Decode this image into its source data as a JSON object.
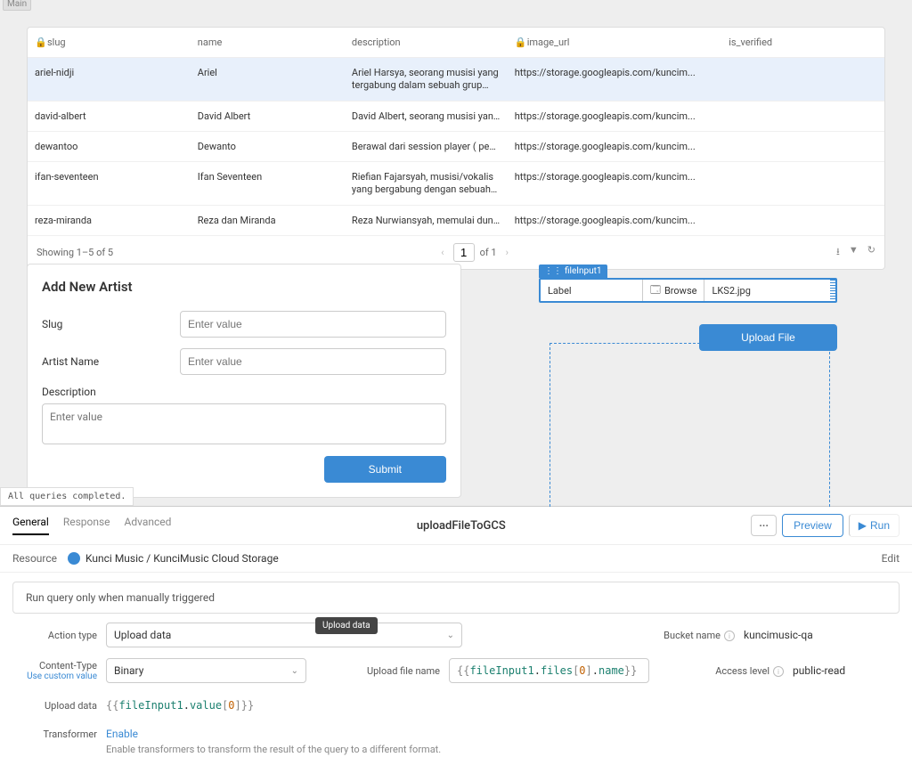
{
  "canvas": {
    "main_label": "Main",
    "status": "All queries completed."
  },
  "table": {
    "columns": [
      {
        "label": "slug",
        "locked": true
      },
      {
        "label": "name",
        "locked": false
      },
      {
        "label": "description",
        "locked": false
      },
      {
        "label": "image_url",
        "locked": true
      },
      {
        "label": "is_verified",
        "locked": false
      }
    ],
    "rows": [
      {
        "slug": "ariel-nidji",
        "name": "Ariel",
        "description": "Ariel Harsya, seorang musisi yang tergabung dalam sebuah grup band musik papan atas",
        "image_url": "https://storage.googleapis.com/kuncim...",
        "is_verified": ""
      },
      {
        "slug": "david-albert",
        "name": "David Albert",
        "description": "David Albert, seorang musisi yang terg...",
        "image_url": "https://storage.googleapis.com/kuncim...",
        "is_verified": ""
      },
      {
        "slug": "dewantoo",
        "name": "Dewanto",
        "description": "Berawal dari session player ( pengiring ...",
        "image_url": "https://storage.googleapis.com/kuncim...",
        "is_verified": ""
      },
      {
        "slug": "ifan-seventeen",
        "name": "Ifan Seventeen",
        "description": "Riefian Fajarsyah, musisi/vokalis yang bergabung dengan sebuah grup musik papan atas",
        "image_url": "https://storage.googleapis.com/kuncim...",
        "is_verified": ""
      },
      {
        "slug": "reza-miranda",
        "name": "Reza dan Miranda",
        "description": "Reza Nurwiansyah, memulai dun musik...",
        "image_url": "https://storage.googleapis.com/kuncim...",
        "is_verified": ""
      }
    ],
    "footer": {
      "showing": "Showing 1–5 of 5",
      "page": "1",
      "of": "of 1"
    }
  },
  "form": {
    "title": "Add New Artist",
    "slug_label": "Slug",
    "name_label": "Artist Name",
    "desc_label": "Description",
    "placeholder": "Enter value",
    "submit": "Submit"
  },
  "file_input": {
    "tag": "fileInput1",
    "label": "Label",
    "browse": "Browse",
    "filename": "LKS2.jpg",
    "upload_btn": "Upload File"
  },
  "query_panel": {
    "tabs": {
      "general": "General",
      "response": "Response",
      "advanced": "Advanced"
    },
    "title": "uploadFileToGCS",
    "preview": "Preview",
    "run": "Run",
    "resource_label": "Resource",
    "resource_name": "Kunci Music / KunciMusic Cloud Storage",
    "edit": "Edit",
    "trigger_text": "Run query only when manually triggered",
    "action_type_label": "Action type",
    "action_type_value": "Upload data",
    "action_type_tooltip": "Upload data",
    "bucket_label": "Bucket name",
    "bucket_value": "kuncimusic-qa",
    "content_type_label": "Content-Type",
    "content_type_sub": "Use custom value",
    "content_type_value": "Binary",
    "upload_name_label": "Upload file name",
    "upload_name_code": {
      "pre": "{{",
      "var": "fileInput1",
      "dot1": ".",
      "prop1": "files",
      "bopen": "[",
      "num": "0",
      "bclose": "]",
      "dot2": ".",
      "prop2": "name",
      "post": "}}"
    },
    "access_label": "Access level",
    "access_value": "public-read",
    "upload_data_label": "Upload data",
    "upload_data_code": {
      "pre": "{{",
      "var": "fileInput1",
      "dot": ".",
      "prop": "value",
      "bopen": "[",
      "num": "0",
      "bclose": "]",
      "post": "}}"
    },
    "transformer_label": "Transformer",
    "transformer_action": "Enable",
    "transformer_help": "Enable transformers to transform the result of the query to a different format."
  }
}
